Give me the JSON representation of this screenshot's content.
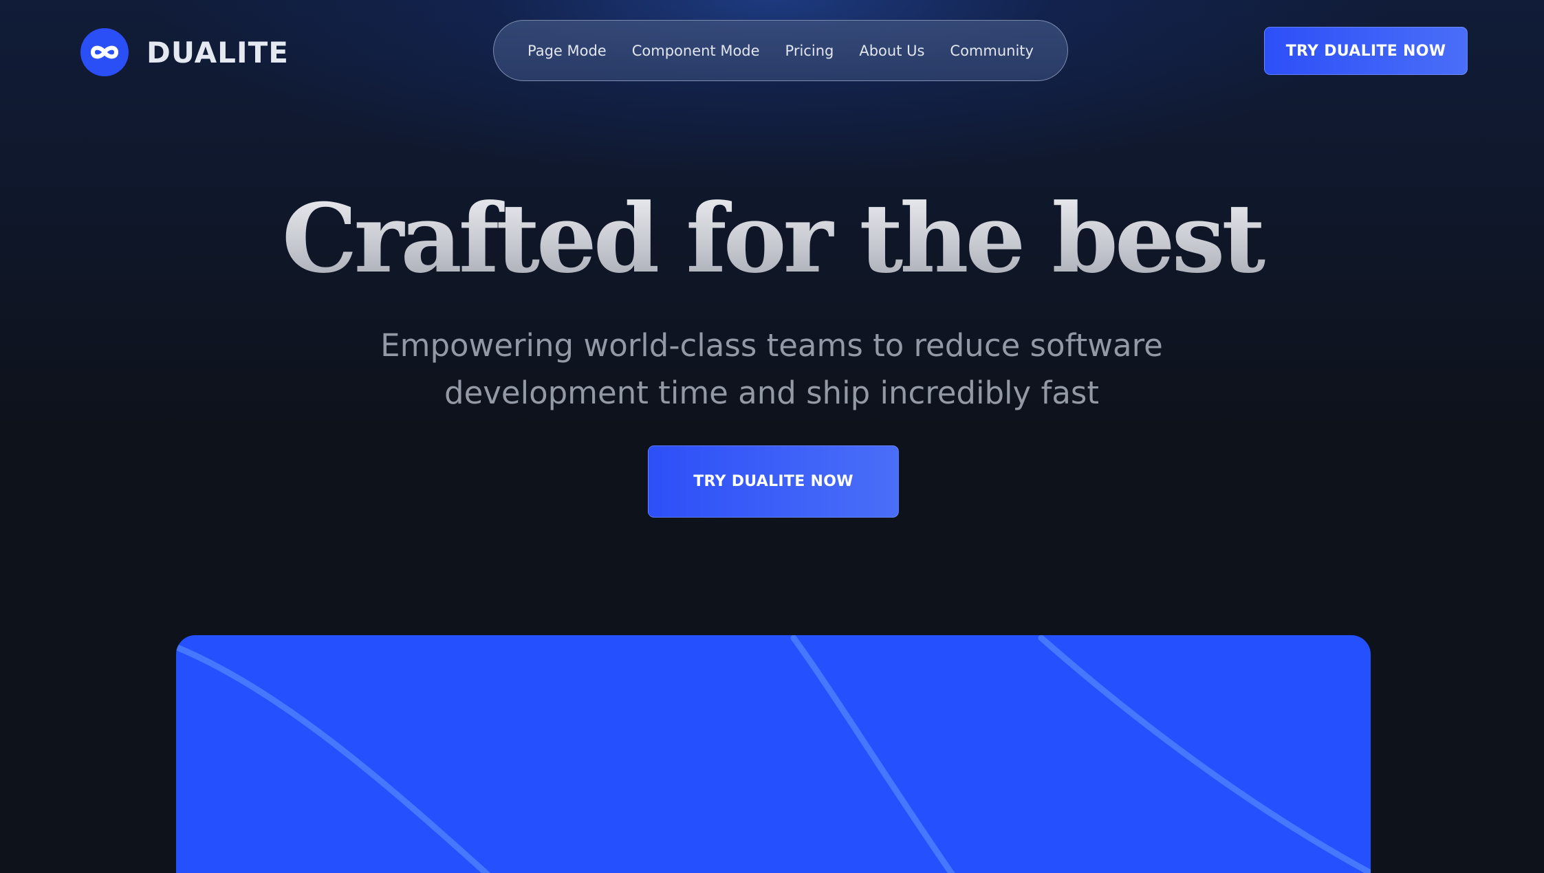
{
  "brand": {
    "name": "DUALITE",
    "logo_icon": "infinity-icon",
    "accent_color": "#2b4ff6"
  },
  "nav": {
    "items": [
      {
        "label": "Page Mode"
      },
      {
        "label": "Component Mode"
      },
      {
        "label": "Pricing"
      },
      {
        "label": "About Us"
      },
      {
        "label": "Community"
      }
    ]
  },
  "header": {
    "cta_label": "TRY DUALITE NOW"
  },
  "hero": {
    "title": "Crafted for the best",
    "subtitle": "Empowering world-class teams to reduce software development time and ship incredibly fast",
    "cta_label": "TRY DUALITE NOW"
  },
  "preview": {
    "background_color": "#2450fd"
  }
}
